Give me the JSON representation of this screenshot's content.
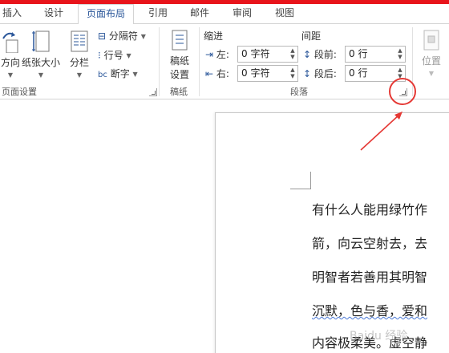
{
  "tabs": [
    "插入",
    "设计",
    "页面布局",
    "引用",
    "邮件",
    "审阅",
    "视图"
  ],
  "page_setup": {
    "direction_label": "方向",
    "paper_size_label": "纸张大小",
    "columns_label": "分栏",
    "separator_label": "分隔符",
    "line_numbers_label": "行号",
    "hyphenation_label": "断字",
    "group_label": "页面设置"
  },
  "draft": {
    "button_label_1": "稿纸",
    "button_label_2": "设置",
    "group_label": "稿纸"
  },
  "paragraph": {
    "indent_header": "缩进",
    "spacing_header": "间距",
    "left_label": "左:",
    "right_label": "右:",
    "before_label": "段前:",
    "after_label": "段后:",
    "left_value": "0 字符",
    "right_value": "0 字符",
    "before_value": "0 行",
    "after_value": "0 行",
    "group_label": "段落"
  },
  "arrange": {
    "position_label": "位置"
  },
  "document": {
    "lines": [
      "有什么人能用绿竹作",
      "箭，向云空射去，去",
      "明智者若善用其明智",
      "沉默，色与香，爱和",
      "内容极柔美。虚空静"
    ]
  },
  "watermark_text": "Baidu 经验",
  "colors": {
    "accent": "#2b579a",
    "annotation": "#e53935",
    "title_bar": "#e8141b"
  }
}
